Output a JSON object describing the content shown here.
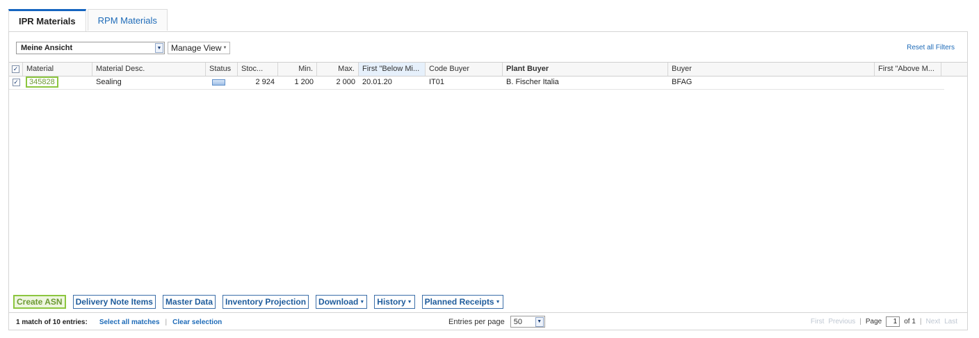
{
  "tabs": [
    {
      "label": "IPR Materials",
      "active": true
    },
    {
      "label": "RPM Materials",
      "active": false
    }
  ],
  "toolbar": {
    "view_value": "Meine Ansicht",
    "manage_view_label": "Manage View",
    "reset_filters_label": "Reset all Filters"
  },
  "columns": [
    "Material",
    "Material Desc.",
    "Status",
    "Stoc...",
    "Min.",
    "Max.",
    "First \"Below Mi...",
    "Code Buyer",
    "Plant Buyer",
    "Buyer",
    "First \"Above M..."
  ],
  "rows": [
    {
      "material": "345828",
      "material_desc": "Sealing",
      "status_icon": "stock-level-bar-icon",
      "stock": "2 924",
      "min": "1 200",
      "max": "2 000",
      "first_below_min": "20.01.20",
      "code_buyer": "IT01",
      "plant_buyer": "B. Fischer Italia",
      "buyer": "BFAG",
      "first_above_max": ""
    }
  ],
  "actions": {
    "create_asn": "Create ASN",
    "delivery_note_items": "Delivery Note Items",
    "master_data": "Master Data",
    "inventory_projection": "Inventory Projection",
    "download": "Download",
    "history": "History",
    "planned_receipts": "Planned Receipts"
  },
  "footer": {
    "match_text": "1 match of 10 entries:",
    "select_all": "Select all matches",
    "clear_selection": "Clear selection",
    "entries_label": "Entries per page",
    "entries_value": "50",
    "first": "First",
    "previous": "Previous",
    "page_label": "Page",
    "page_value": "1",
    "of_label": "of 1",
    "next": "Next",
    "last": "Last"
  },
  "colors": {
    "accent_blue": "#1e6bb8",
    "highlight_green": "#8cc63f"
  }
}
